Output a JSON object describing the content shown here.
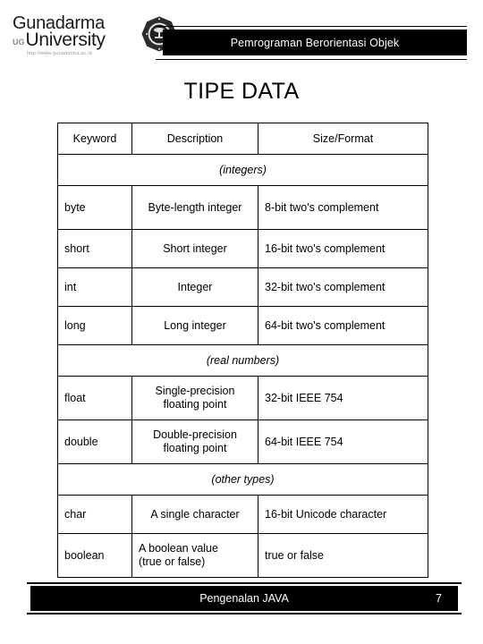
{
  "header": {
    "brand": {
      "line1": "Gunadarma",
      "prefix": "UG",
      "line2": "University",
      "url": "http://www.gunadarma.ac.id",
      "seal_icon": "university-seal-icon"
    },
    "bar_title": "Pemrograman Berorientasi Objek"
  },
  "slide": {
    "title": "TIPE DATA"
  },
  "table": {
    "columns": [
      "Keyword",
      "Description",
      "Size/Format"
    ],
    "sections": [
      {
        "label": "(integers)",
        "rows": [
          {
            "keyword": "byte",
            "description": "Byte-length integer",
            "size": "8-bit two's complement"
          },
          {
            "keyword": "short",
            "description": "Short integer",
            "size": "16-bit two's complement"
          },
          {
            "keyword": "int",
            "description": "Integer",
            "size": "32-bit two's complement"
          },
          {
            "keyword": "long",
            "description": "Long integer",
            "size": "64-bit two's complement"
          }
        ]
      },
      {
        "label": "(real numbers)",
        "rows": [
          {
            "keyword": "float",
            "description": "Single-precision floating point",
            "size": "32-bit IEEE 754"
          },
          {
            "keyword": "double",
            "description": "Double-precision floating point",
            "size": "64-bit IEEE 754"
          }
        ]
      },
      {
        "label": "(other types)",
        "rows": [
          {
            "keyword": "char",
            "description": "A single character",
            "size": "16-bit Unicode character"
          },
          {
            "keyword": "boolean",
            "description": "A boolean value\n(true or false)",
            "size": "true or false"
          }
        ]
      }
    ]
  },
  "footer": {
    "title": "Pengenalan JAVA",
    "page_number": "7"
  },
  "colors": {
    "bar_background": "#000000",
    "bar_text": "#ffffff",
    "page_background": "#ffffff",
    "rule": "#000000"
  }
}
